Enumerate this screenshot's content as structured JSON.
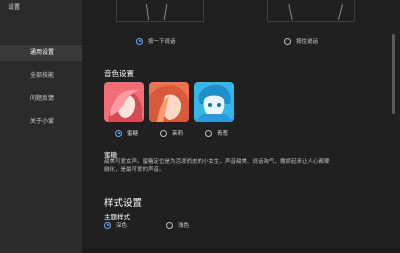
{
  "window": {
    "title": "设置",
    "minimize": "—",
    "maximize": "☐",
    "close": "✕"
  },
  "sidebar": {
    "items": [
      {
        "label": "通用设置",
        "active": true
      },
      {
        "label": "全部技能",
        "active": false
      },
      {
        "label": "问题反馈",
        "active": false
      },
      {
        "label": "关于小爱",
        "active": false
      }
    ]
  },
  "wake": {
    "options": [
      {
        "label": "按一下说话",
        "selected": true
      },
      {
        "label": "按住说话",
        "selected": false
      }
    ]
  },
  "voice": {
    "section_title": "音色设置",
    "options": [
      {
        "label": "蜜糖",
        "selected": true,
        "icon": "pink-girl-avatar"
      },
      {
        "label": "茉莉",
        "selected": false,
        "icon": "orange-girl-avatar"
      },
      {
        "label": "青葱",
        "selected": false,
        "icon": "blue-boy-avatar"
      }
    ],
    "selected_name": "蜜糖",
    "selected_desc": "甜美可爱女声。蜜糖定位是为活泼俏皮的小女生，声音甜美、说话淘气，撒娇起来让人心都要融化，是最可爱的声音。"
  },
  "style": {
    "section_title": "样式设置",
    "theme_label": "主题样式",
    "options": [
      {
        "label": "深色",
        "selected": true
      },
      {
        "label": "浅色",
        "selected": false
      }
    ]
  },
  "colors": {
    "accent": "#6aa9ff",
    "background": "#202020",
    "sidebar": "#2b2b2b"
  }
}
